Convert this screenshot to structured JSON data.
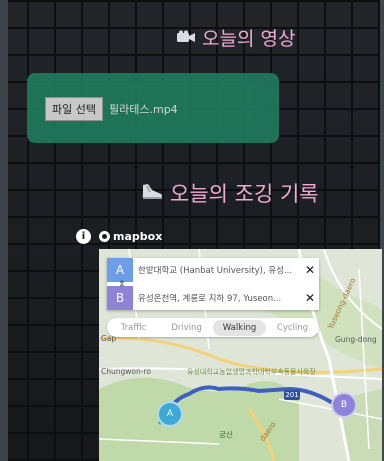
{
  "video_section": {
    "icon": "video-camera-icon",
    "title": "오늘의 영상"
  },
  "upload": {
    "button_label": "파일 선택",
    "file_name": "필라테스.mp4"
  },
  "jog_section": {
    "icon": "running-shoe-icon",
    "title": "오늘의 조깅 기록"
  },
  "map_attribution": {
    "info_icon": "i",
    "logo_text": "mapbox"
  },
  "directions": {
    "origin_badge": "A",
    "origin_text": "한밭대학교 (Hanbat University), 유성...",
    "destination_badge": "B",
    "destination_text": "유성온천역, 계룡로 지하 97, Yuseon...",
    "close_symbol": "✕",
    "reverse_symbol": "⇕"
  },
  "profiles": [
    {
      "label": "Traffic",
      "active": false
    },
    {
      "label": "Driving",
      "active": false
    },
    {
      "label": "Walking",
      "active": true
    },
    {
      "label": "Cycling",
      "active": false
    }
  ],
  "map_labels": {
    "gap": "Gap",
    "gung_dong": "Gung-dong",
    "chungwon": "Chungwon-ro",
    "yuseong_daero": "Yuseong-daero",
    "campus": "유성대학교농업생명과학대학부속동물사육장",
    "daero": "daero",
    "samu": "궁산",
    "road_shield": "201"
  },
  "markers": {
    "start": "A",
    "end": "B"
  },
  "colors": {
    "title_pink": "#f3a9d6",
    "upload_green": "#1f7a5c",
    "route_blue": "#3f5fbf",
    "badge_a": "#6b9ee6",
    "badge_b": "#8f83d9"
  }
}
